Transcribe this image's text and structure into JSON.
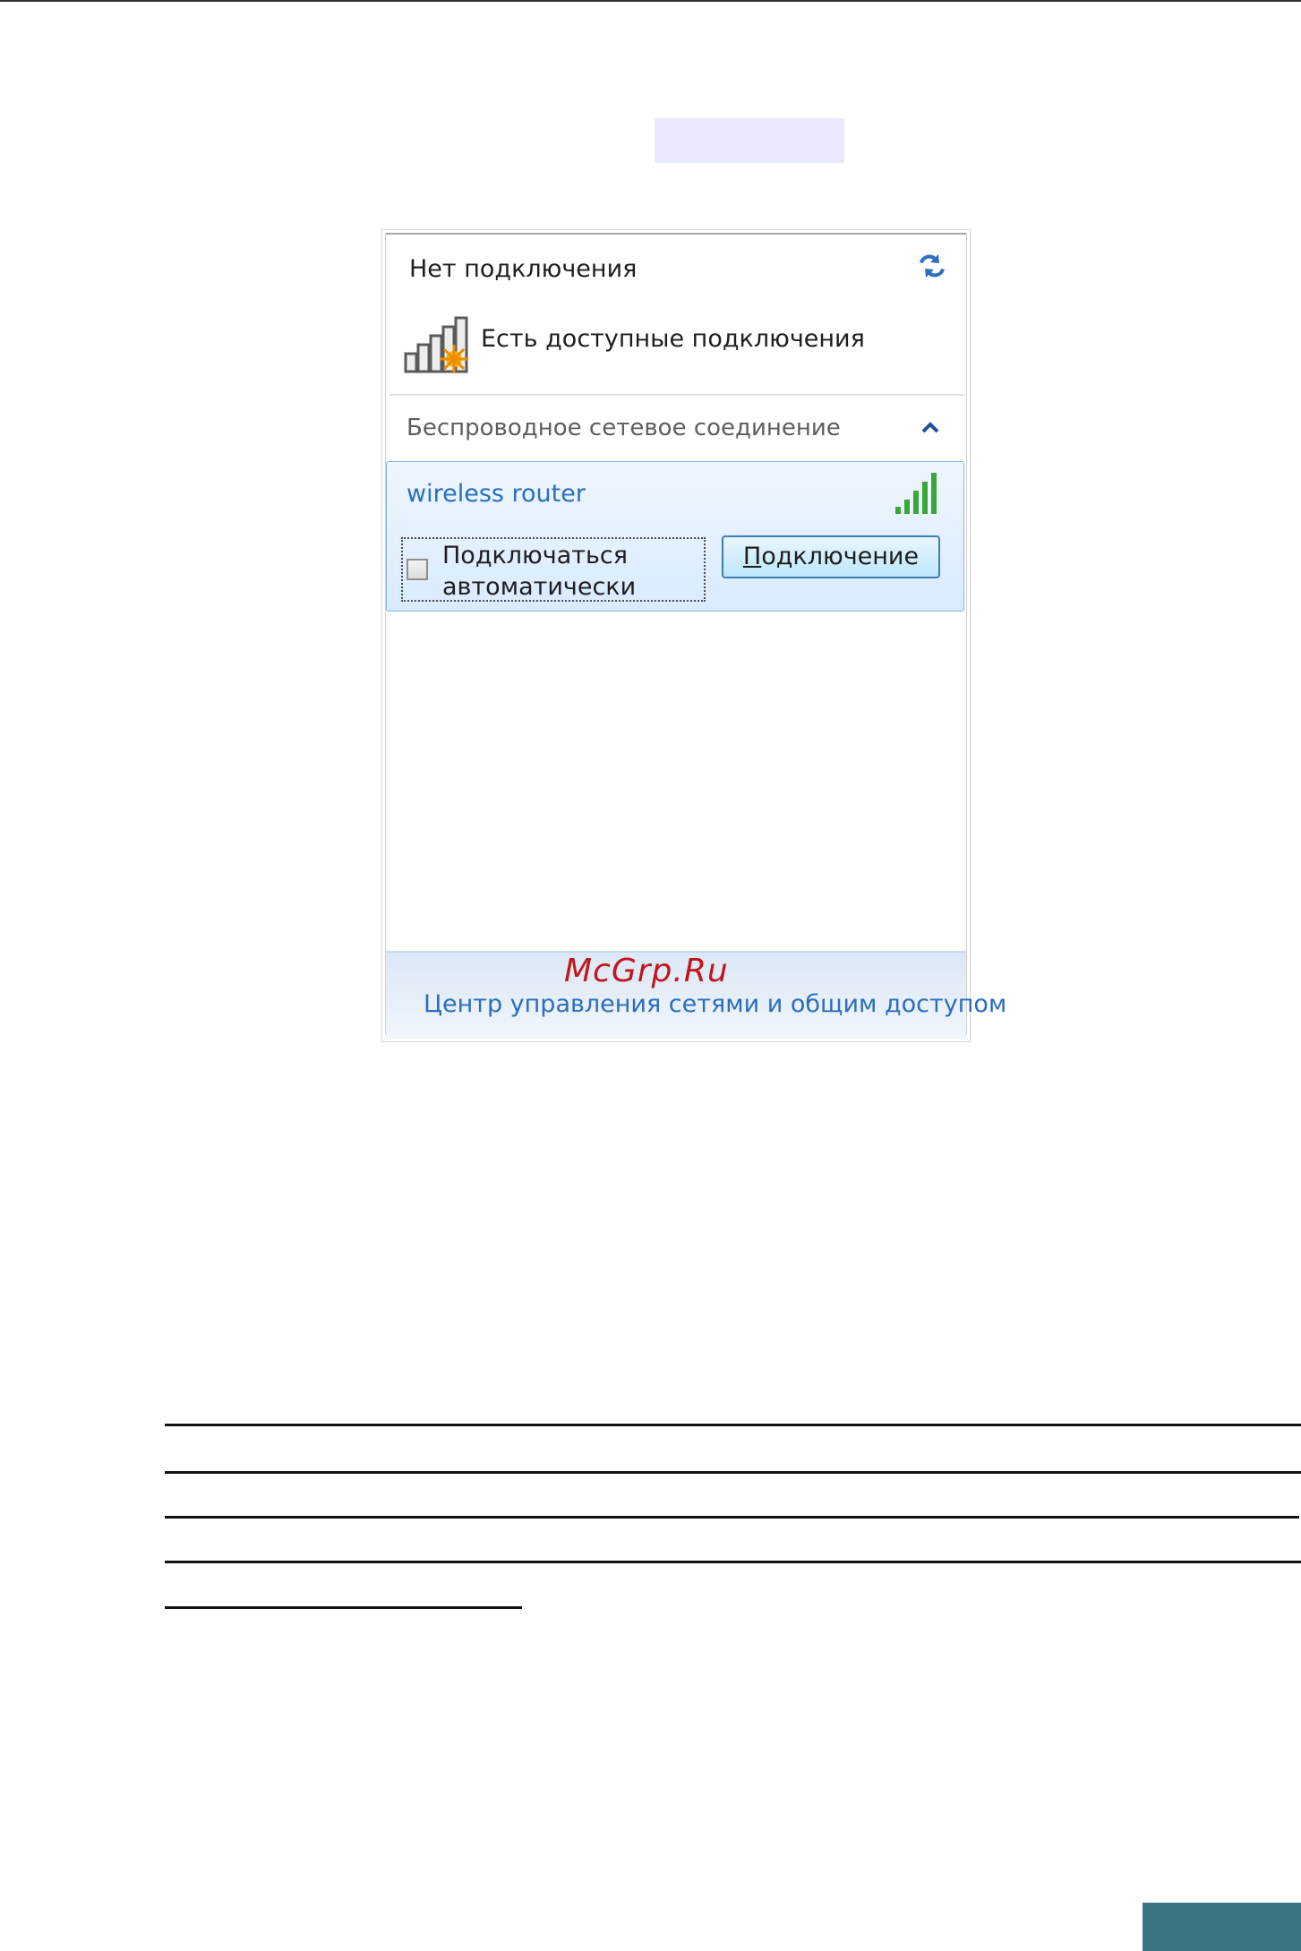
{
  "network_flyout": {
    "status_title": "Нет подключения",
    "status_subtitle": "Есть доступные подключения",
    "section_title": "Беспроводное сетевое соединение",
    "network": {
      "name": "wireless router",
      "auto_connect_label": "Подключаться автоматически",
      "auto_connect_checked": false,
      "connect_button_label_underlined": "П",
      "connect_button_label_rest": "одключение"
    },
    "footer_link": "Центр управления сетями и общим доступом"
  },
  "watermark": "McGrp.Ru",
  "colors": {
    "link_blue": "#2a6ebd",
    "selection_bg": "#d9ebff",
    "signal_green": "#3aa635",
    "corner_block": "#3b7585",
    "watermark_red": "#c4151c"
  },
  "icons": [
    "refresh-icon",
    "signal-warning-icon",
    "chevron-up-icon",
    "signal-strength-icon",
    "checkbox"
  ]
}
